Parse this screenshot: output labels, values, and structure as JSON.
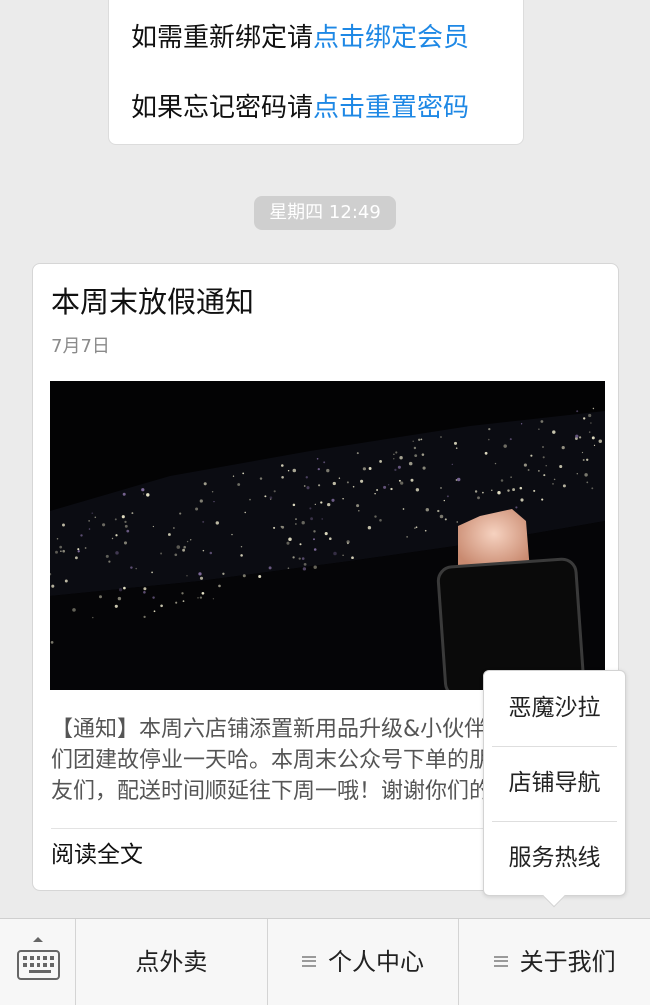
{
  "previous_message": {
    "line1_prefix": "如需重新绑定请",
    "line1_link": "点击绑定会员",
    "line2_prefix": "如果忘记密码请",
    "line2_link": "点击重置密码"
  },
  "timestamp": "星期四 12:49",
  "article": {
    "title": "本周末放假通知",
    "date": "7月7日",
    "summary": "【通知】本周六店铺添置新用品升级&小伙伴们团建故停业一天哈。本周末公众号下单的朋友们，配送时间顺延往下周一哦！谢谢你们的支持~~~",
    "read_more": "阅读全文"
  },
  "popup_menu": {
    "items": [
      {
        "label": "恶魔沙拉"
      },
      {
        "label": "店铺导航"
      },
      {
        "label": "服务热线"
      }
    ]
  },
  "bottom_menu": {
    "keyboard_icon": "keyboard-icon",
    "menu_icon": "hamburger-icon",
    "items": [
      {
        "label": "点外卖"
      },
      {
        "label": "个人中心"
      },
      {
        "label": "关于我们"
      }
    ]
  },
  "colors": {
    "link": "#1e88e5",
    "background": "#ebebeb",
    "timestamp_bg": "#cfcfcf"
  }
}
